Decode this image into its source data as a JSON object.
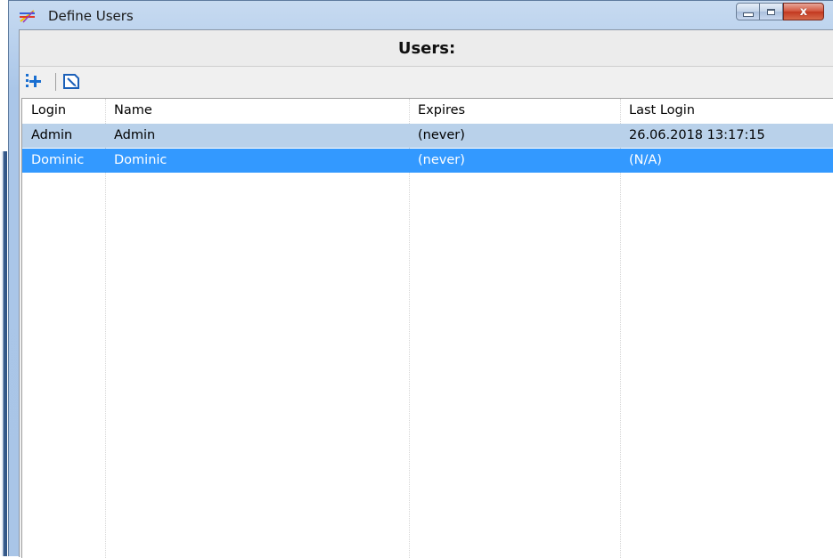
{
  "window": {
    "title": "Define Users",
    "close_label": "x"
  },
  "header": {
    "title": "Users:"
  },
  "toolbar": {
    "buttons": [
      {
        "icon": "add-user-icon"
      },
      {
        "icon": "edit-user-icon"
      }
    ]
  },
  "table": {
    "columns": [
      "Login",
      "Name",
      "Expires",
      "Last Login"
    ],
    "rows": [
      {
        "login": "Admin",
        "name": "Admin",
        "expires": "(never)",
        "last_login": "26.06.2018 13:17:15"
      },
      {
        "login": "Dominic",
        "name": "Dominic",
        "expires": "(never)",
        "last_login": "(N/A)"
      }
    ],
    "selected_row": 1
  },
  "colors": {
    "row_highlight": "#b9d1ea",
    "row_selected": "#3399ff",
    "add_icon": "#1a6fd1"
  }
}
